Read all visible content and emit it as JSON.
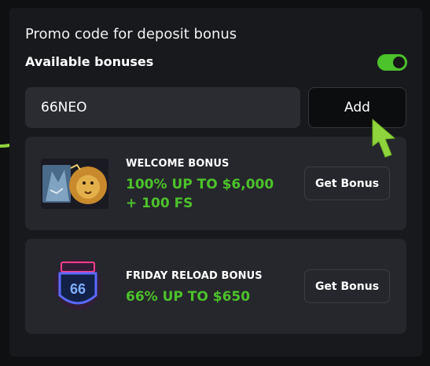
{
  "panel": {
    "title": "Promo code for deposit bonus",
    "available_label": "Available bonuses",
    "toggle_on": true
  },
  "promo": {
    "value": "66NEO",
    "add_label": "Add"
  },
  "bonuses": [
    {
      "name": "WELCOME BONUS",
      "offer_line1": "100% UP TO $6,000",
      "offer_line2": "+ 100 FS",
      "button_label": "Get Bonus",
      "thumbnail_icon": "lion-wolf-art-icon"
    },
    {
      "name": "FRIDAY RELOAD BONUS",
      "offer_line1": "66% UP TO $650",
      "button_label": "Get Bonus",
      "thumbnail_icon": "route-66-neon-sign-icon"
    }
  ],
  "colors": {
    "accent_green": "#4cc22b",
    "panel_bg": "#18191c",
    "card_bg": "#26272c",
    "arrow_green": "#8fd43d"
  }
}
